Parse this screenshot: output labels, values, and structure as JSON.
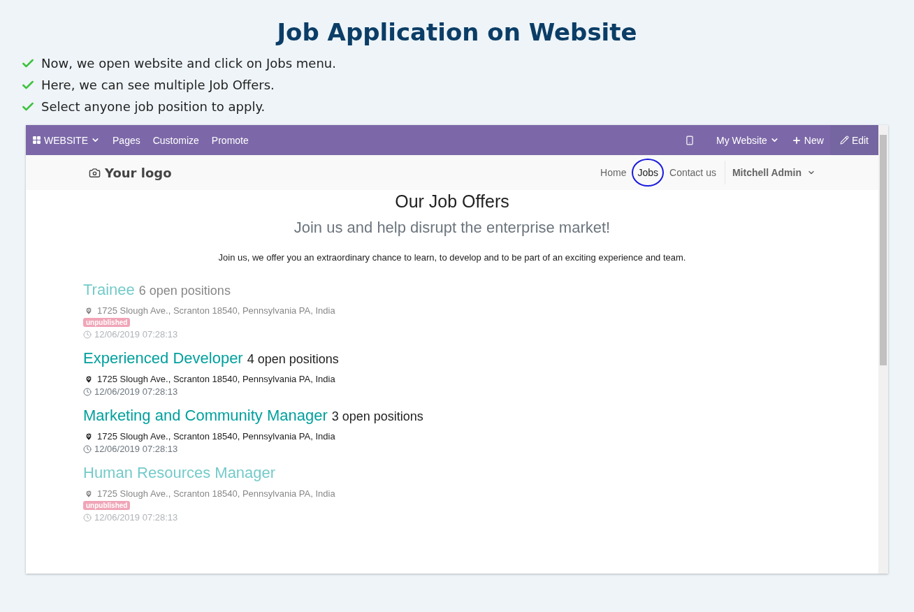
{
  "title": "Job Application on Website",
  "steps": [
    "Now, we open website and click on Jobs menu.",
    "Here, we can see multiple Job Offers.",
    "Select anyone job position to apply."
  ],
  "admin_bar": {
    "left": [
      {
        "label": "WEBSITE",
        "kind": "apps"
      },
      {
        "label": "Pages",
        "kind": "plain"
      },
      {
        "label": "Customize",
        "kind": "plain"
      },
      {
        "label": "Promote",
        "kind": "plain"
      }
    ],
    "right": [
      {
        "kind": "mobile"
      },
      {
        "label": "My Website",
        "kind": "dropdown"
      },
      {
        "label": "New",
        "kind": "new"
      },
      {
        "label": "Edit",
        "kind": "edit"
      }
    ]
  },
  "site_nav": {
    "logo": "Your logo",
    "items": [
      {
        "label": "Home",
        "highlighted": false
      },
      {
        "label": "Jobs",
        "highlighted": true
      },
      {
        "label": "Contact us",
        "highlighted": false
      }
    ],
    "user": "Mitchell Admin"
  },
  "heading": "Our Job Offers",
  "subheading": "Join us and help disrupt the enterprise market!",
  "intro": "Join us, we offer you an extraordinary chance to learn, to develop and to be part of an exciting experience and team.",
  "jobs": [
    {
      "title": "Trainee",
      "openings": "6 open positions",
      "address": "1725 Slough Ave., Scranton 18540, Pennsylvania PA, India",
      "published": false,
      "badge": "unpublished",
      "date": "12/06/2019 07:28:13"
    },
    {
      "title": "Experienced Developer",
      "openings": "4 open positions",
      "address": "1725 Slough Ave., Scranton 18540, Pennsylvania PA, India",
      "published": true,
      "date": "12/06/2019 07:28:13"
    },
    {
      "title": "Marketing and Community Manager",
      "openings": "3 open positions",
      "address": "1725 Slough Ave., Scranton 18540, Pennsylvania PA, India",
      "published": true,
      "date": "12/06/2019 07:28:13"
    },
    {
      "title": "Human Resources Manager",
      "address": "1725 Slough Ave., Scranton 18540, Pennsylvania PA, India",
      "published": false,
      "badge": "unpublished",
      "date": "12/06/2019 07:28:13"
    }
  ]
}
